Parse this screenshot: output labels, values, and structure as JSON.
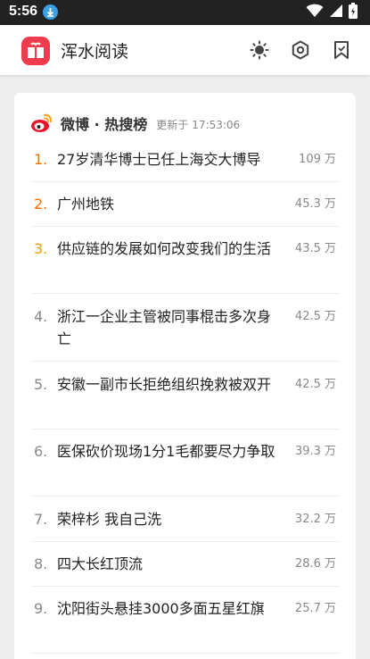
{
  "status_bar": {
    "time": "5:56"
  },
  "app_bar": {
    "title": "浑水阅读"
  },
  "hot_search": {
    "title": "微博 · 热搜榜",
    "updated_label": "更新于",
    "updated_time": "17:53:06",
    "items": [
      {
        "rank": "1.",
        "title": "27岁清华博士已任上海交大博导",
        "count": "109 万"
      },
      {
        "rank": "2.",
        "title": "广州地铁",
        "count": "45.3 万"
      },
      {
        "rank": "3.",
        "title": "供应链的发展如何改变我们的生活",
        "count": "43.5 万"
      },
      {
        "rank": "4.",
        "title": "浙江一企业主管被同事棍击多次身亡",
        "count": "42.5 万"
      },
      {
        "rank": "5.",
        "title": "安徽一副市长拒绝组织挽救被双开",
        "count": "42.5 万"
      },
      {
        "rank": "6.",
        "title": "医保砍价现场1分1毛都要尽力争取",
        "count": "39.3 万"
      },
      {
        "rank": "7.",
        "title": "荣梓杉 我自己洗",
        "count": "32.2 万"
      },
      {
        "rank": "8.",
        "title": "四大长红顶流",
        "count": "28.6 万"
      },
      {
        "rank": "9.",
        "title": "沈阳街头悬挂3000多面五星红旗",
        "count": "25.7 万"
      }
    ]
  },
  "colors": {
    "accent_red": "#ef3b4e",
    "rank_top": "#ff6a00",
    "rank_third": "#f0a000"
  },
  "icons": {
    "logo": "book-icon",
    "theme": "brightness-icon",
    "settings": "gear-icon",
    "bookmark": "bookmark-icon",
    "weibo": "weibo-icon"
  }
}
